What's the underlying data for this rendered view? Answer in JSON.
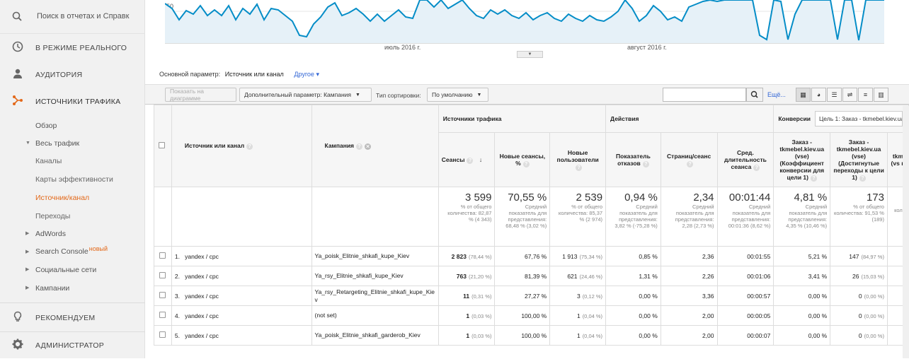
{
  "sidebar": {
    "search": "Поиск в отчетах и Справк",
    "realtime": "В РЕЖИМЕ РЕАЛЬНОГО",
    "audience": "АУДИТОРИЯ",
    "traffic": "ИСТОЧНИКИ ТРАФИКА",
    "overview": "Обзор",
    "all_traffic": "Весь трафик",
    "channels": "Каналы",
    "treemaps": "Карты эффективности",
    "source_medium": "Источник/канал",
    "referrals": "Переходы",
    "adwords": "AdWords",
    "search_console": "Search Console",
    "new_badge": "новый",
    "social": "Социальные сети",
    "campaigns": "Кампании",
    "recommend": "РЕКОМЕНДУЕМ",
    "admin": "АДМИНИСТРАТОР"
  },
  "chart": {
    "ytick": "50",
    "x_labels": [
      "июль 2016 г.",
      "август 2016 г."
    ],
    "line_color": "#058dc7"
  },
  "dimension": {
    "label": "Основной параметр:",
    "value": "Источник или канал",
    "other": "Другое"
  },
  "toolbar": {
    "plot": "Показать на диаграмме",
    "secondary": "Дополнительный параметр: Кампания",
    "sort_label": "Тип сортировки:",
    "sort_value": "По умолчанию",
    "more": "Ещё..."
  },
  "table": {
    "group_traffic": "Источники трафика",
    "group_actions": "Действия",
    "group_conv": "Конверсии",
    "goal_select": "Цель 1: Заказ - tkmebel.kiev.ua",
    "col_source": "Источник или канал",
    "col_campaign": "Кампания",
    "col_sessions": "Сеансы",
    "col_new_sessions": "Новые сеансы, %",
    "col_new_users": "Новые пользователи",
    "col_bounce": "Показатель отказов",
    "col_pages": "Страниц/сеанс",
    "col_duration": "Сред. длительность сеанса",
    "col_conv_rate": "Заказ - tkmebel.kiev.ua (vse) (Коэффициент конверсии для цели 1)",
    "col_completions": "Заказ - tkmebel.kiev.ua (vse) (Достигнутые переходы к цели 1)",
    "col_value": "tkm (vs ц",
    "totals": {
      "sessions": "3 599",
      "sessions_sub": "% от общего количества: 82,87 % (4 343)",
      "new_sessions": "70,55 %",
      "new_sessions_sub": "Средний показатель для представления: 68,48 % (3,02 %)",
      "new_users": "2 539",
      "new_users_sub": "% от общего количества: 85,37 % (2 974)",
      "bounce": "0,94 %",
      "bounce_sub": "Средний показатель для представления: 3,82 % (-75,28 %)",
      "pages": "2,34",
      "pages_sub": "Средний показатель для представления: 2,28 (2,73 %)",
      "duration": "00:01:44",
      "duration_sub": "Средний показатель для представления: 00:01:36 (8,62 %)",
      "conv_rate": "4,81 %",
      "conv_rate_sub": "Средний показатель для представления: 4,35 % (10,46 %)",
      "completions": "173",
      "completions_sub": "% от общего количества: 91,53 % (189)",
      "value_sub": "коли"
    },
    "rows": [
      {
        "n": "1.",
        "source": "yandex / cpc",
        "campaign": "Ya_poisk_Elitnie_shkafi_kupe_Kiev",
        "sessions": "2 823",
        "sessions_pct": "(78,44 %)",
        "new_sessions": "67,76 %",
        "new_users": "1 913",
        "new_users_pct": "(75,34 %)",
        "bounce": "0,85 %",
        "pages": "2,36",
        "duration": "00:01:55",
        "conv": "5,21 %",
        "comp": "147",
        "comp_pct": "(84,97 %)"
      },
      {
        "n": "2.",
        "source": "yandex / cpc",
        "campaign": "Ya_rsy_Elitnie_shkafi_kupe_Kiev",
        "sessions": "763",
        "sessions_pct": "(21,20 %)",
        "new_sessions": "81,39 %",
        "new_users": "621",
        "new_users_pct": "(24,46 %)",
        "bounce": "1,31 %",
        "pages": "2,26",
        "duration": "00:01:06",
        "conv": "3,41 %",
        "comp": "26",
        "comp_pct": "(15,03 %)"
      },
      {
        "n": "3.",
        "source": "yandex / cpc",
        "campaign": "Ya_rsy_Retargeting_Elitnie_shkafi_kupe_Kiev",
        "sessions": "11",
        "sessions_pct": "(0,31 %)",
        "new_sessions": "27,27 %",
        "new_users": "3",
        "new_users_pct": "(0,12 %)",
        "bounce": "0,00 %",
        "pages": "3,36",
        "duration": "00:00:57",
        "conv": "0,00 %",
        "comp": "0",
        "comp_pct": "(0,00 %)"
      },
      {
        "n": "4.",
        "source": "yandex / cpc",
        "campaign": "(not set)",
        "sessions": "1",
        "sessions_pct": "(0,03 %)",
        "new_sessions": "100,00 %",
        "new_users": "1",
        "new_users_pct": "(0,04 %)",
        "bounce": "0,00 %",
        "pages": "2,00",
        "duration": "00:00:05",
        "conv": "0,00 %",
        "comp": "0",
        "comp_pct": "(0,00 %)"
      },
      {
        "n": "5.",
        "source": "yandex / cpc",
        "campaign": "Ya_poisk_Elitnie_shkafi_garderob_Kiev",
        "sessions": "1",
        "sessions_pct": "(0,03 %)",
        "new_sessions": "100,00 %",
        "new_users": "1",
        "new_users_pct": "(0,04 %)",
        "bounce": "0,00 %",
        "pages": "2,00",
        "duration": "00:00:07",
        "conv": "0,00 %",
        "comp": "0",
        "comp_pct": "(0,00 %)"
      }
    ]
  },
  "colors": {
    "accent": "#e3691a",
    "link": "#3367d6"
  }
}
